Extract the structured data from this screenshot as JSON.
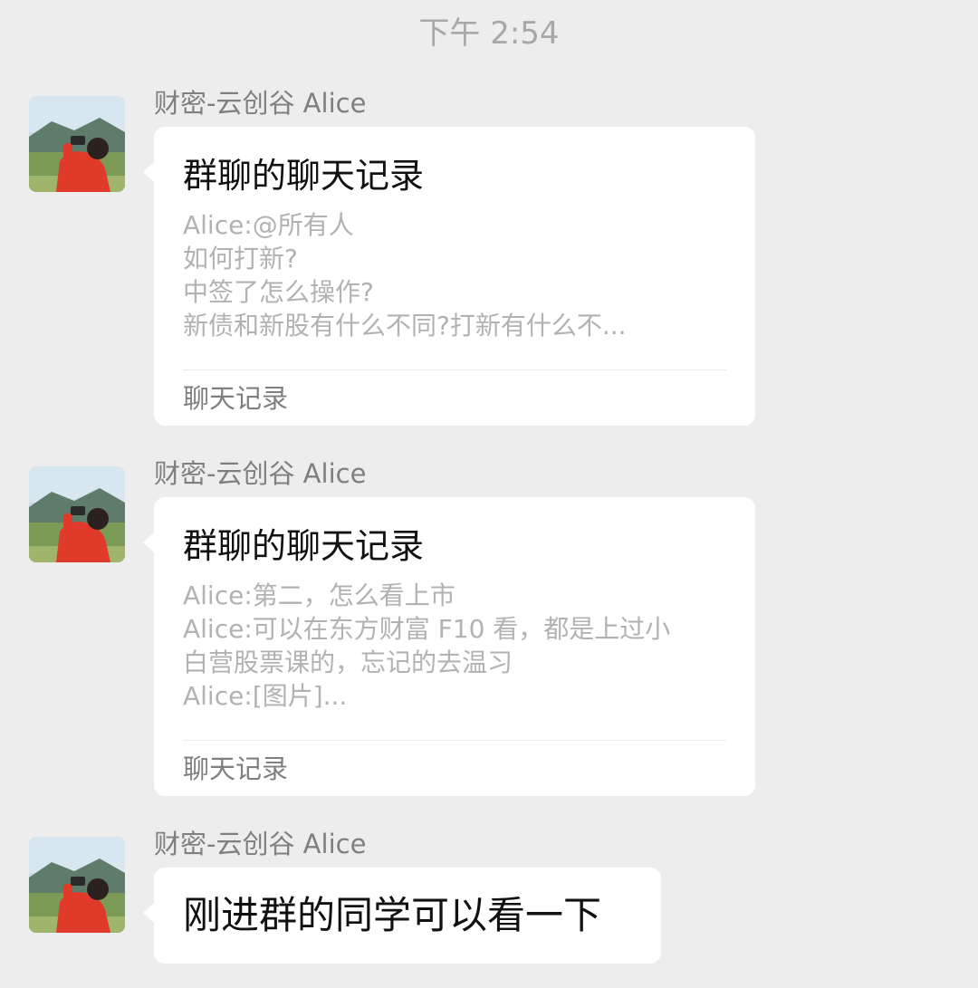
{
  "timestamp": "下午 2:54",
  "messages": [
    {
      "sender": "财密-云创谷 Alice",
      "type": "chat_record",
      "title": "群聊的聊天记录",
      "lines": [
        "Alice:@所有人",
        "如何打新?",
        "中签了怎么操作?",
        "新债和新股有什么不同?打新有什么不..."
      ],
      "footer": "聊天记录"
    },
    {
      "sender": "财密-云创谷 Alice",
      "type": "chat_record",
      "title": "群聊的聊天记录",
      "lines": [
        "Alice:第二，怎么看上市",
        "Alice:可以在东方财富 F10 看，都是上过小",
        "白营股票课的，忘记的去温习",
        "Alice:[图片]..."
      ],
      "footer": "聊天记录"
    },
    {
      "sender": "财密-云创谷 Alice",
      "type": "text",
      "text": "刚进群的同学可以看一下"
    }
  ],
  "icons": {
    "avatar": "avatar-photo-icon"
  }
}
